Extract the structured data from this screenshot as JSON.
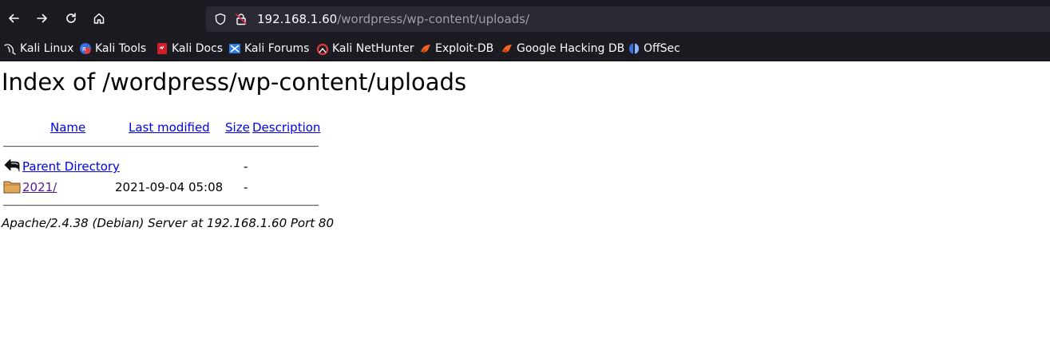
{
  "browser": {
    "url_host": "192.168.1.60",
    "url_path": "/wordpress/wp-content/uploads/",
    "bookmarks": [
      {
        "label": "Kali Linux",
        "icon": "kali-dragon-icon"
      },
      {
        "label": "Kali Tools",
        "icon": "kali-tools-icon"
      },
      {
        "label": "Kali Docs",
        "icon": "kali-docs-icon"
      },
      {
        "label": "Kali Forums",
        "icon": "kali-forums-icon"
      },
      {
        "label": "Kali NetHunter",
        "icon": "kali-nethunter-icon"
      },
      {
        "label": "Exploit-DB",
        "icon": "exploit-db-icon"
      },
      {
        "label": "Google Hacking DB",
        "icon": "ghdb-icon"
      },
      {
        "label": "OffSec",
        "icon": "offsec-icon"
      }
    ]
  },
  "page": {
    "title": "Index of /wordpress/wp-content/uploads",
    "columns": {
      "name": "Name",
      "last_modified": "Last modified",
      "size": "Size",
      "description": "Description"
    },
    "rows": [
      {
        "name": "Parent Directory",
        "last_modified": "",
        "size": "-",
        "icon": "back-arrow-icon"
      },
      {
        "name": "2021/",
        "last_modified": "2021-09-04 05:08",
        "size": "-",
        "icon": "folder-icon"
      }
    ],
    "footer": "Apache/2.4.38 (Debian) Server at 192.168.1.60 Port 80"
  },
  "colors": {
    "chrome_bg": "#1c1b22",
    "urlbar_bg": "#2b2a33",
    "link": "#0000ee",
    "visited_link": "#551a8b"
  }
}
